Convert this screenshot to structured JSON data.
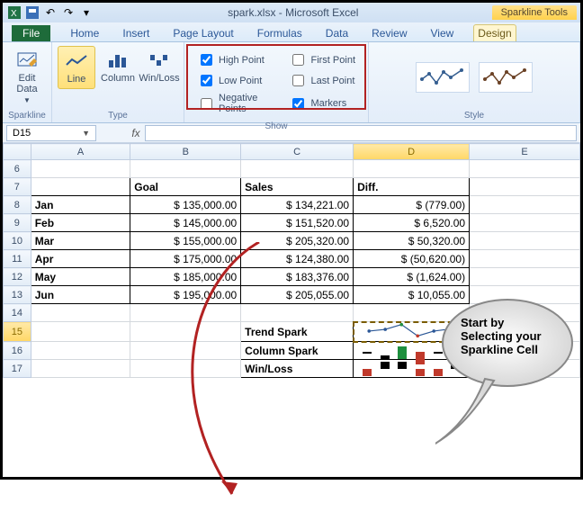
{
  "title": "spark.xlsx - Microsoft Excel",
  "context_tab": "Sparkline Tools",
  "tabs": {
    "file": "File",
    "home": "Home",
    "insert": "Insert",
    "page_layout": "Page Layout",
    "formulas": "Formulas",
    "data": "Data",
    "review": "Review",
    "view": "View",
    "design": "Design"
  },
  "ribbon": {
    "sparkline": {
      "edit": "Edit Data",
      "group": "Sparkline"
    },
    "type": {
      "line": "Line",
      "column": "Column",
      "winloss": "Win/Loss",
      "group": "Type"
    },
    "show": {
      "high": "High Point",
      "low": "Low Point",
      "neg": "Negative Points",
      "first": "First Point",
      "last": "Last Point",
      "markers": "Markers",
      "group": "Show"
    },
    "style": {
      "group": "Style"
    }
  },
  "namebox": "D15",
  "columns": [
    "A",
    "B",
    "C",
    "D",
    "E"
  ],
  "rows": {
    "headers": {
      "b": "Goal",
      "c": "Sales",
      "d": "Diff."
    },
    "data": [
      {
        "r": "8",
        "a": "Jan",
        "b": "$ 135,000.00",
        "c": "$ 134,221.00",
        "d": "$      (779.00)"
      },
      {
        "r": "9",
        "a": "Feb",
        "b": "$ 145,000.00",
        "c": "$ 151,520.00",
        "d": "$    6,520.00"
      },
      {
        "r": "10",
        "a": "Mar",
        "b": "$ 155,000.00",
        "c": "$ 205,320.00",
        "d": "$  50,320.00"
      },
      {
        "r": "11",
        "a": "Apr",
        "b": "$ 175,000.00",
        "c": "$ 124,380.00",
        "d": "$ (50,620.00)"
      },
      {
        "r": "12",
        "a": "May",
        "b": "$ 185,000.00",
        "c": "$ 183,376.00",
        "d": "$  (1,624.00)"
      },
      {
        "r": "13",
        "a": "Jun",
        "b": "$ 195,000.00",
        "c": "$ 205,055.00",
        "d": "$  10,055.00"
      }
    ],
    "sparks": {
      "r15": "Trend Spark",
      "r16": "Column Spark",
      "r17": "Win/Loss"
    }
  },
  "callout": "Start by Selecting your Sparkline Cell",
  "chart_data": [
    {
      "type": "line",
      "title": "Trend Spark (Diff.)",
      "categories": [
        "Jan",
        "Feb",
        "Mar",
        "Apr",
        "May",
        "Jun"
      ],
      "values": [
        -779,
        6520,
        50320,
        -50620,
        -1624,
        10055
      ],
      "markers": true,
      "high_point": 50320,
      "low_point": -50620
    },
    {
      "type": "bar",
      "title": "Column Spark (Diff.)",
      "categories": [
        "Jan",
        "Feb",
        "Mar",
        "Apr",
        "May",
        "Jun"
      ],
      "values": [
        -779,
        6520,
        50320,
        -50620,
        -1624,
        10055
      ]
    },
    {
      "type": "bar",
      "title": "Win/Loss (Diff. sign)",
      "categories": [
        "Jan",
        "Feb",
        "Mar",
        "Apr",
        "May",
        "Jun"
      ],
      "values": [
        -1,
        1,
        1,
        -1,
        -1,
        1
      ]
    }
  ]
}
